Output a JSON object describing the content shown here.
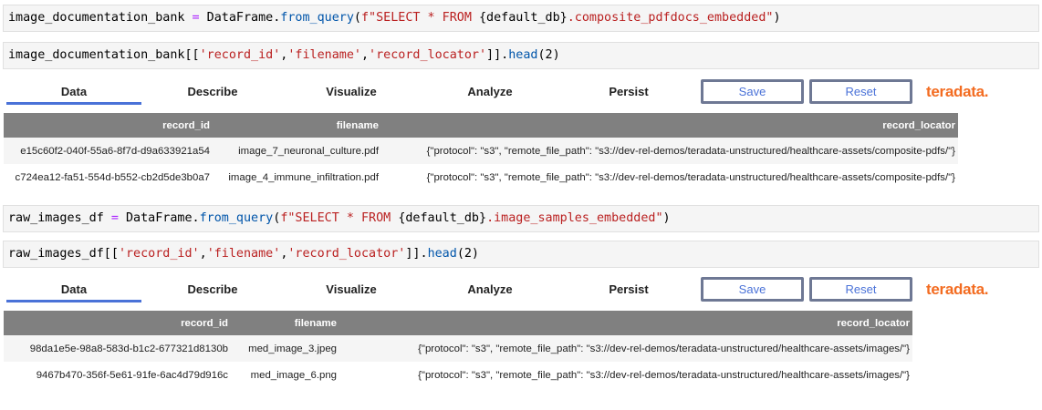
{
  "cells": [
    {
      "var": "image_documentation_bank",
      "eq": " = ",
      "obj": "DataFrame.",
      "fn": "from_query",
      "open": "(",
      "str": "f\"SELECT * FROM ",
      "mid": "{default_db}",
      "str2": ".composite_pdfdocs_embedded\"",
      "close": ")"
    },
    {
      "pre": "image_documentation_bank[[",
      "a": "'record_id'",
      "c1": ",",
      "b": "'filename'",
      "c2": ",",
      "c": "'record_locator'",
      "post": "]].",
      "fn": "head",
      "args": "(2)"
    },
    {
      "var": "raw_images_df",
      "eq": " = ",
      "obj": "DataFrame.",
      "fn": "from_query",
      "open": "(",
      "str": "f\"SELECT * FROM ",
      "mid": "{default_db}",
      "str2": ".image_samples_embedded\"",
      "close": ")"
    },
    {
      "pre": "raw_images_df[[",
      "a": "'record_id'",
      "c1": ",",
      "b": "'filename'",
      "c2": ",",
      "c": "'record_locator'",
      "post": "]].",
      "fn": "head",
      "args": "(2)"
    }
  ],
  "tabs": [
    "Data",
    "Describe",
    "Visualize",
    "Analyze",
    "Persist"
  ],
  "buttons": {
    "save": "Save",
    "reset": "Reset"
  },
  "logo": "teradata.",
  "colors": {
    "accent": "#4a72d8",
    "logo": "#f36c21",
    "header": "#808080"
  },
  "table1": {
    "columns": [
      "record_id",
      "filename",
      "record_locator"
    ],
    "rows": [
      [
        "e15c60f2-040f-55a6-8f7d-d9a633921a54",
        "image_7_neuronal_culture.pdf",
        "{\"protocol\": \"s3\", \"remote_file_path\": \"s3://dev-rel-demos/teradata-unstructured/healthcare-assets/composite-pdfs/\"}"
      ],
      [
        "c724ea12-fa51-554d-b552-cb2d5de3b0a7",
        "image_4_immune_infiltration.pdf",
        "{\"protocol\": \"s3\", \"remote_file_path\": \"s3://dev-rel-demos/teradata-unstructured/healthcare-assets/composite-pdfs/\"}"
      ]
    ]
  },
  "table2": {
    "columns": [
      "record_id",
      "filename",
      "record_locator"
    ],
    "rows": [
      [
        "98da1e5e-98a8-583d-b1c2-677321d8130b",
        "med_image_3.jpeg",
        "{\"protocol\": \"s3\", \"remote_file_path\": \"s3://dev-rel-demos/teradata-unstructured/healthcare-assets/images/\"}"
      ],
      [
        "9467b470-356f-5e61-91fe-6ac4d79d916c",
        "med_image_6.png",
        "{\"protocol\": \"s3\", \"remote_file_path\": \"s3://dev-rel-demos/teradata-unstructured/healthcare-assets/images/\"}"
      ]
    ]
  }
}
